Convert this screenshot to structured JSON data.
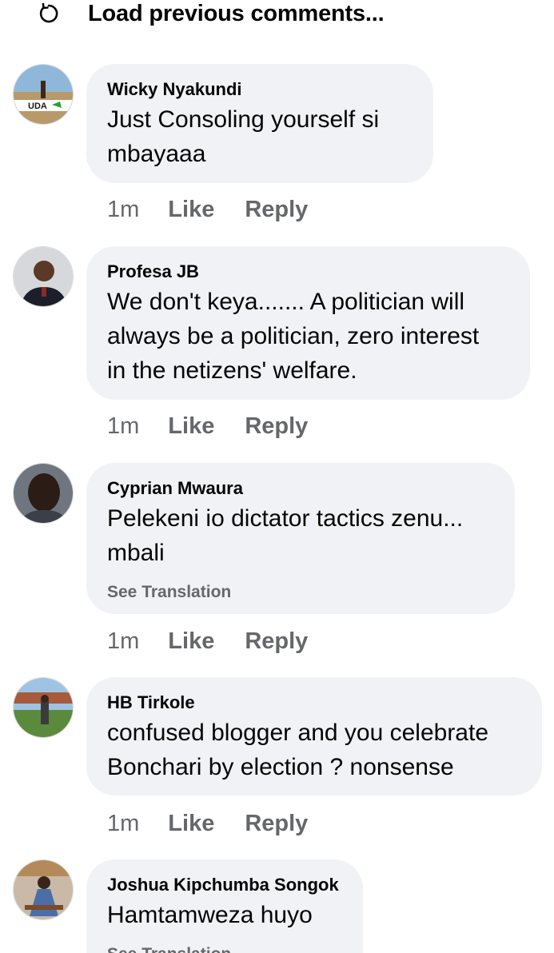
{
  "load_previous": {
    "label": "Load previous comments...",
    "icon": "reload-icon"
  },
  "comments": [
    {
      "author": "Wicky Nyakundi",
      "avatar_text": "UDA",
      "lines": [
        "Just Consoling  yourself si",
        "mbayaaa"
      ],
      "see_translation": "",
      "time": "1m",
      "like": "Like",
      "reply": "Reply"
    },
    {
      "author": "Profesa JB",
      "lines": [
        "We don't keya....... A politician will",
        "always be a politician, zero interest",
        "in the netizens' welfare."
      ],
      "see_translation": "",
      "time": "1m",
      "like": "Like",
      "reply": "Reply"
    },
    {
      "author": "Cyprian Mwaura",
      "lines": [
        "Pelekeni io dictator tactics zenu...",
        "mbali"
      ],
      "see_translation": "See Translation",
      "time": "1m",
      "like": "Like",
      "reply": "Reply"
    },
    {
      "author": "HB Tirkole",
      "lines": [
        "confused blogger and you celebrate",
        "Bonchari by election ? nonsense"
      ],
      "see_translation": "",
      "time": "1m",
      "like": "Like",
      "reply": "Reply"
    },
    {
      "author": "Joshua Kipchumba Songok",
      "lines": [
        "Hamtamweza huyo"
      ],
      "see_translation": "See Translation"
    }
  ],
  "colors": {
    "bubble": "#f0f2f5",
    "secondary_text": "#65676b",
    "primary_text": "#050505"
  }
}
